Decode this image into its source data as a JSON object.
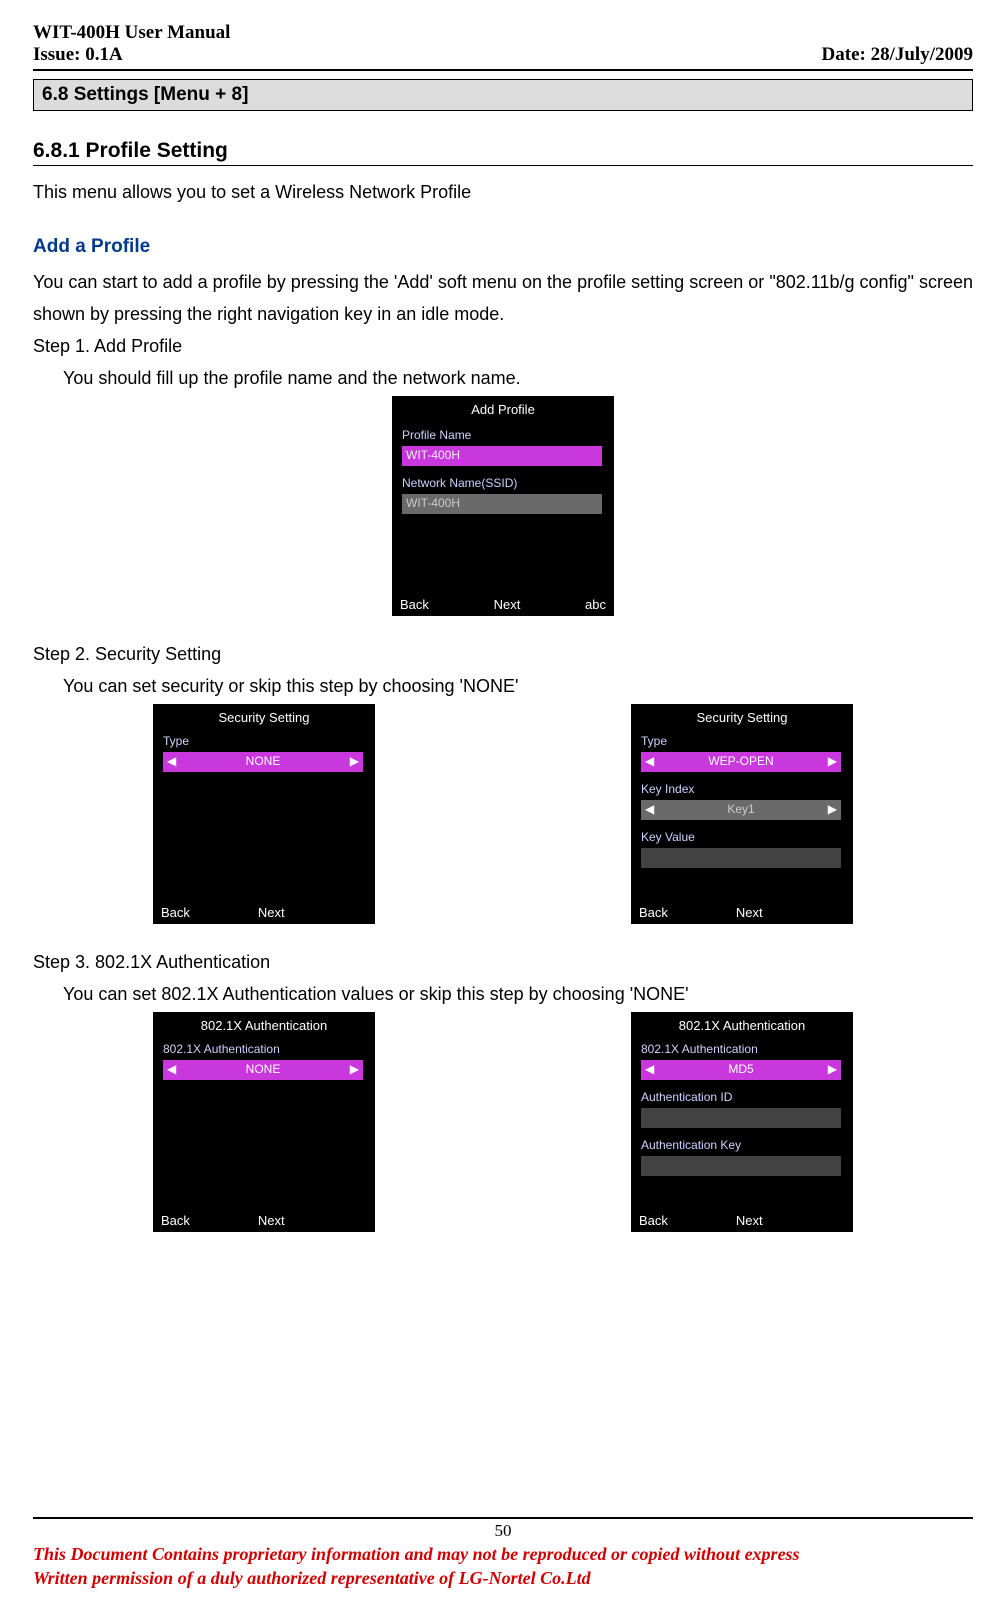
{
  "header": {
    "title": "WIT-400H User Manual",
    "issue": "Issue: 0.1A",
    "date": "Date: 28/July/2009"
  },
  "section_bar": "6.8        Settings [Menu + 8]",
  "subsection": "6.8.1    Profile Setting",
  "intro": "This menu allows you to set a Wireless Network Profile",
  "add_profile_h": "Add a Profile",
  "add_profile_p1": "You can start to add a profile by pressing the 'Add' soft menu on the profile setting screen or \"802.11b/g config\" screen shown by pressing the right navigation key in an idle mode.",
  "step1_h": "Step 1. Add Profile",
  "step1_p": "You should fill up the profile name and the network name.",
  "phone1": {
    "title": "Add Profile",
    "label1": "Profile Name",
    "value1": "WIT-400H",
    "label2": "Network Name(SSID)",
    "value2": "WIT-400H",
    "soft_l": "Back",
    "soft_c": "Next",
    "soft_r": "abc"
  },
  "step2_h": "Step 2. Security Setting",
  "step2_p": "You can set security or skip this step by choosing 'NONE'",
  "phone2a": {
    "title": "Security Setting",
    "label1": "Type",
    "value1": "NONE",
    "soft_l": "Back",
    "soft_c": "Next"
  },
  "phone2b": {
    "title": "Security Setting",
    "label1": "Type",
    "value1": "WEP-OPEN",
    "label2": "Key Index",
    "value2": "Key1",
    "label3": "Key Value",
    "soft_l": "Back",
    "soft_c": "Next"
  },
  "step3_h": "Step 3. 802.1X Authentication",
  "step3_p": "You can set 802.1X Authentication values or skip this step by choosing 'NONE'",
  "phone3a": {
    "title": "802.1X Authentication",
    "label1": "802.1X Authentication",
    "value1": "NONE",
    "soft_l": "Back",
    "soft_c": "Next"
  },
  "phone3b": {
    "title": "802.1X Authentication",
    "label1": "802.1X Authentication",
    "value1": "MD5",
    "label2": "Authentication ID",
    "label3": "Authentication Key",
    "soft_l": "Back",
    "soft_c": "Next"
  },
  "page_number": "50",
  "disclaimer_l1": "This Document Contains proprietary information and may not be reproduced or copied without express",
  "disclaimer_l2": "Written permission of a duly authorized representative of LG-Nortel Co.Ltd"
}
